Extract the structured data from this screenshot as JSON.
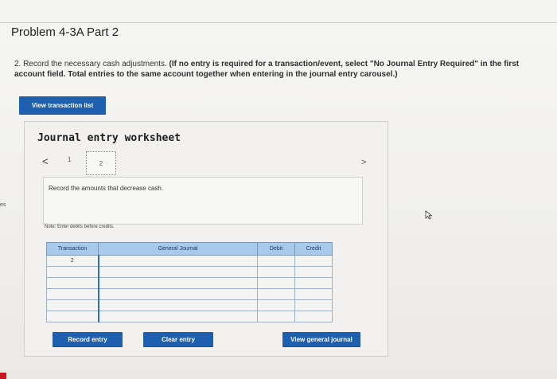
{
  "problem": {
    "title": "Problem 4-3A Part 2",
    "instruction_main": "2. Record the necessary cash adjustments.",
    "instruction_bold": "(If no entry is required for a transaction/event, select \"No Journal Entry Required\" in the first account field. Total entries to the same account together when entering in the journal entry carousel.)"
  },
  "edge_text": "es",
  "buttons": {
    "view_transaction_list": "View transaction list",
    "record_entry": "Record entry",
    "clear_entry": "Clear entry",
    "view_general_journal": "View general journal"
  },
  "worksheet": {
    "heading": "Journal entry worksheet",
    "nav_prev": "<",
    "nav_next": ">",
    "tabs": [
      "1",
      "2"
    ],
    "active_tab": "2",
    "description": "Record the amounts that decrease cash.",
    "note": "Note: Enter debits before credits."
  },
  "table": {
    "headers": {
      "transaction": "Transaction",
      "general_journal": "General Journal",
      "debit": "Debit",
      "credit": "Credit"
    },
    "rows": [
      {
        "transaction": "2",
        "general_journal": "",
        "debit": "",
        "credit": ""
      },
      {
        "transaction": "",
        "general_journal": "",
        "debit": "",
        "credit": ""
      },
      {
        "transaction": "",
        "general_journal": "",
        "debit": "",
        "credit": ""
      },
      {
        "transaction": "",
        "general_journal": "",
        "debit": "",
        "credit": ""
      },
      {
        "transaction": "",
        "general_journal": "",
        "debit": "",
        "credit": ""
      },
      {
        "transaction": "",
        "general_journal": "",
        "debit": "",
        "credit": ""
      }
    ]
  },
  "colors": {
    "button_blue": "#1f5fb0",
    "table_header": "#a9c9ea",
    "input_focus": "#2a6fc5"
  }
}
